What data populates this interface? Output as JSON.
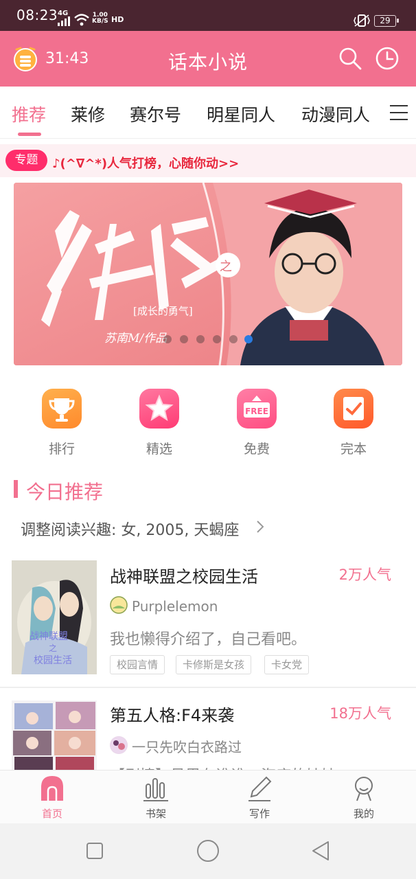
{
  "status_bar": {
    "time": "08:23",
    "network": "4G",
    "speed_value": "1.00",
    "speed_unit": "KB/S",
    "hd": "HD",
    "battery": "29"
  },
  "app_bar": {
    "timer": "31:43",
    "title": "话本小说",
    "icons": [
      "alarm-timer-icon",
      "search-icon",
      "history-clock-icon"
    ]
  },
  "tabs": {
    "items": [
      "推荐",
      "莱修",
      "赛尔号",
      "明星同人",
      "动漫同人"
    ],
    "active_index": 0
  },
  "topic": {
    "badge": "专题",
    "text": "♪(^∇^*)人气打榜，心随你动>>"
  },
  "banner": {
    "title_art": "少年派之",
    "subtitle": "[成长的勇气]",
    "author": "苏南M/作品",
    "dot_count": 6,
    "active_dot": 5
  },
  "quick_actions": [
    {
      "label": "排行",
      "icon": "trophy-icon",
      "color": "#ff9d3b"
    },
    {
      "label": "精选",
      "icon": "star-icon",
      "color": "#ff4f84"
    },
    {
      "label": "免费",
      "icon": "free-tag-icon",
      "color": "#ff5b8e"
    },
    {
      "label": "完本",
      "icon": "checklist-icon",
      "color": "#ff6a3c"
    }
  ],
  "section": {
    "title": "今日推荐",
    "interest": "调整阅读兴趣: 女, 2005, 天蝎座"
  },
  "books": [
    {
      "title": "战神联盟之校园生活",
      "popularity": "2万人气",
      "author": "Purplelemon",
      "desc": "我也懒得介绍了，自己看吧。",
      "tags": [
        "校园言情",
        "卡修斯是女孩",
        "卡女党"
      ]
    },
    {
      "title": "第五人格:F4来袭",
      "popularity": "18万人气",
      "author": "一只先吹白衣路过",
      "desc": "【剧情】号里有谁谁，海底的娃娃……",
      "tags": []
    }
  ],
  "bottom_nav": {
    "items": [
      {
        "label": "首页",
        "icon": "home-icon"
      },
      {
        "label": "书架",
        "icon": "bookshelf-icon"
      },
      {
        "label": "写作",
        "icon": "pencil-icon"
      },
      {
        "label": "我的",
        "icon": "profile-icon"
      }
    ],
    "active_index": 0
  },
  "colors": {
    "accent": "#f2708f",
    "status_bar": "#4a2530",
    "topic_badge": "#ff2d6b",
    "topic_text": "#e8283e"
  }
}
